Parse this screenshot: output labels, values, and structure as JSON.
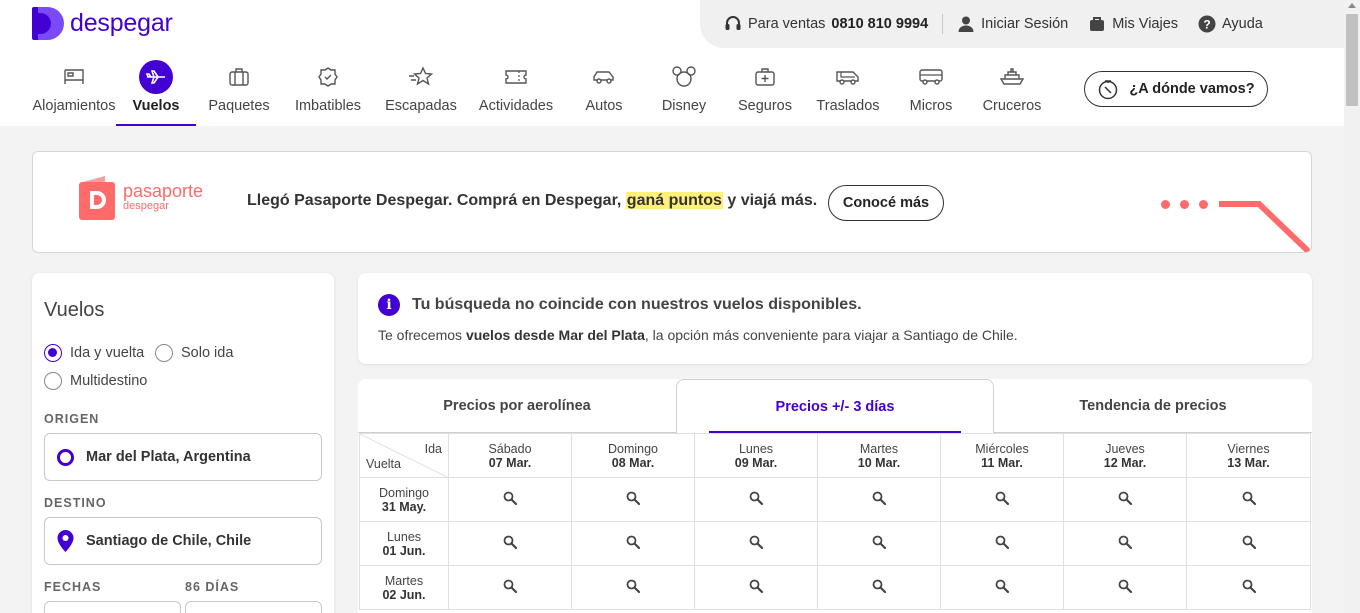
{
  "brand": {
    "name": "despegar",
    "color": "#4300d2",
    "accent": "#ff6a6a"
  },
  "topbar": {
    "sales_prefix": "Para ventas",
    "sales_phone": "0810 810 9994",
    "login": "Iniciar Sesión",
    "trips": "Mis Viajes",
    "help": "Ayuda"
  },
  "nav": {
    "items": [
      {
        "label": "Alojamientos",
        "icon": "bed-icon"
      },
      {
        "label": "Vuelos",
        "icon": "plane-icon",
        "active": true
      },
      {
        "label": "Paquetes",
        "icon": "suitcase-icon"
      },
      {
        "label": "Imbatibles",
        "icon": "badge-icon"
      },
      {
        "label": "Escapadas",
        "icon": "star-speed-icon"
      },
      {
        "label": "Actividades",
        "icon": "ticket-icon"
      },
      {
        "label": "Autos",
        "icon": "car-icon"
      },
      {
        "label": "Disney",
        "icon": "mickey-icon"
      },
      {
        "label": "Seguros",
        "icon": "medkit-icon"
      },
      {
        "label": "Traslados",
        "icon": "van-icon"
      },
      {
        "label": "Micros",
        "icon": "bus-icon"
      },
      {
        "label": "Cruceros",
        "icon": "ship-icon"
      }
    ],
    "where_button": "¿A dónde vamos?"
  },
  "banner": {
    "logo_line1": "pasaporte",
    "logo_line2": "despegar",
    "text_before": "Llegó Pasaporte Despegar. Comprá en Despegar, ",
    "text_highlight": "ganá puntos",
    "text_after": " y viajá más.",
    "button": "Conocé más"
  },
  "search": {
    "title": "Vuelos",
    "trip_types": [
      "Ida y vuelta",
      "Solo ida",
      "Multidestino"
    ],
    "selected_trip_type": "Ida y vuelta",
    "origin_label": "ORIGEN",
    "origin_value": "Mar del Plata, Argentina",
    "destination_label": "DESTINO",
    "destination_value": "Santiago de Chile, Chile",
    "dates_label": "FECHAS",
    "days_label": "86 DÍAS"
  },
  "notice": {
    "title": "Tu búsqueda no coincide con nuestros vuelos disponibles.",
    "body_before": "Te ofrecemos ",
    "body_bold": "vuelos desde Mar del Plata",
    "body_after": ", la opción más conveniente para viajar a Santiago de Chile."
  },
  "tabs": [
    "Precios por aerolínea",
    "Precios +/- 3 días",
    "Tendencia de precios"
  ],
  "active_tab": "Precios +/- 3 días",
  "grid": {
    "corner_ida": "Ida",
    "corner_vuelta": "Vuelta",
    "columns": [
      {
        "day": "Sábado",
        "date": "07 Mar."
      },
      {
        "day": "Domingo",
        "date": "08 Mar."
      },
      {
        "day": "Lunes",
        "date": "09 Mar."
      },
      {
        "day": "Martes",
        "date": "10 Mar."
      },
      {
        "day": "Miércoles",
        "date": "11 Mar."
      },
      {
        "day": "Jueves",
        "date": "12 Mar."
      },
      {
        "day": "Viernes",
        "date": "13 Mar."
      }
    ],
    "rows": [
      {
        "day": "Domingo",
        "date": "31 May."
      },
      {
        "day": "Lunes",
        "date": "01 Jun."
      },
      {
        "day": "Martes",
        "date": "02 Jun."
      }
    ]
  }
}
